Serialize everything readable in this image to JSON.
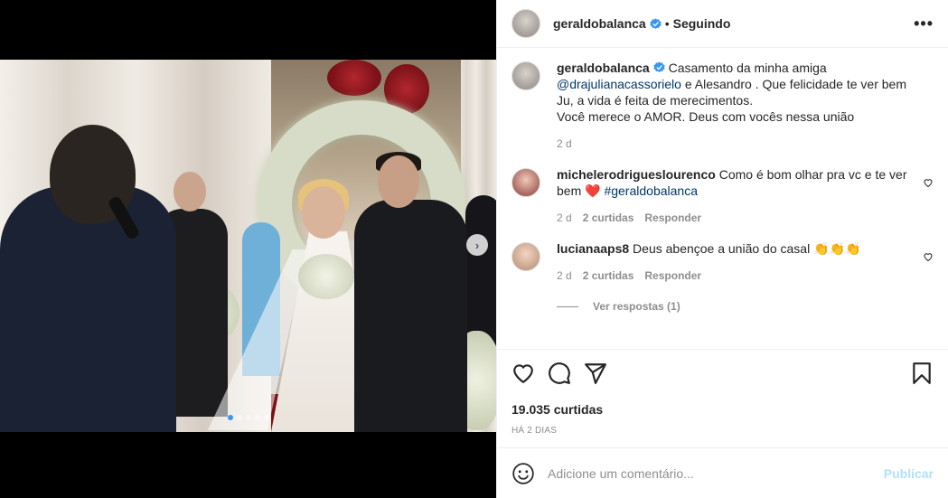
{
  "media": {
    "carousel_next_icon": "chevron-right-icon",
    "dots_total": 5,
    "dots_active_index": 0
  },
  "post": {
    "author": {
      "username": "geraldobalanca",
      "verified": true,
      "verified_color": "#3897f0",
      "separator": "•",
      "follow_status": "Seguindo"
    },
    "more_icon": "more-options-icon",
    "caption": {
      "username": "geraldobalanca",
      "text_before": " Casamento da minha amiga ",
      "mention": "@drajulianacassorielo",
      "text_after": " e Alesandro . Que felicidade te ver bem Ju, a vida é feita de merecimentos.",
      "line2": "Você merece o AMOR. Deus com vocês nessa união",
      "age": "2 d"
    },
    "comments": [
      {
        "username": "michelerodrigueslourenco",
        "text": " Como é bom olhar pra vc e te ver bem ",
        "emoji": "❤️",
        "hashtag": " #geraldobalanca",
        "age": "2 d",
        "likes": "2 curtidas",
        "reply_label": "Responder"
      },
      {
        "username": "lucianaaps8",
        "text": " Deus abençoe a união do casal ",
        "emoji": "👏👏👏",
        "age": "2 d",
        "likes": "2 curtidas",
        "reply_label": "Responder",
        "view_replies": "Ver respostas (1)"
      }
    ],
    "actions": {
      "like_icon": "heart-icon",
      "comment_icon": "comment-icon",
      "share_icon": "share-icon",
      "save_icon": "bookmark-icon"
    },
    "likes_count": "19.035 curtidas",
    "posted": "HÁ 2 DIAS",
    "add_comment": {
      "emoji_icon": "smiley-icon",
      "placeholder": "Adicione um comentário...",
      "publish_label": "Publicar",
      "publish_color": "#b2dffc"
    }
  }
}
